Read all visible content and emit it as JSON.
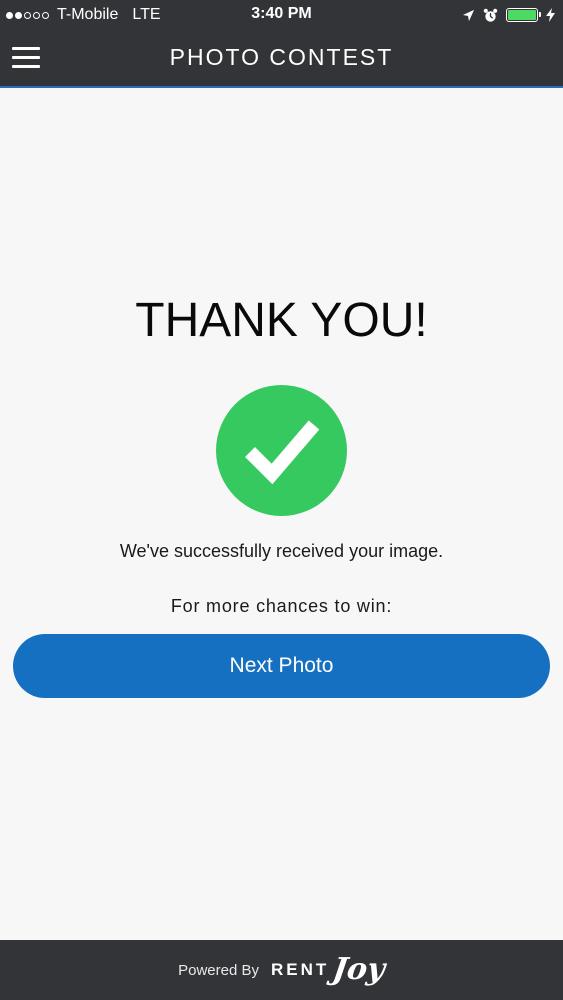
{
  "status_bar": {
    "carrier": "T-Mobile",
    "network": "LTE",
    "time": "3:40 PM",
    "signal_strength": 2,
    "signal_max": 5,
    "battery_level": 1.0,
    "battery_color": "#4cd964",
    "icons": [
      "location-arrow-icon",
      "alarm-clock-icon",
      "battery-icon",
      "charging-bolt-icon"
    ]
  },
  "nav": {
    "title": "PHOTO CONTEST",
    "menu_icon": "hamburger-menu-icon",
    "accent_color": "#2a6fb5"
  },
  "main": {
    "heading": "THANK YOU!",
    "success_icon": "checkmark-circle-icon",
    "success_color": "#36c95f",
    "message": "We've successfully received your image.",
    "prompt": "For more chances to win:",
    "next_button_label": "Next Photo",
    "button_color": "#1570c1"
  },
  "footer": {
    "powered_by": "Powered By",
    "brand_part1": "RENT",
    "brand_part2": "Joy"
  }
}
